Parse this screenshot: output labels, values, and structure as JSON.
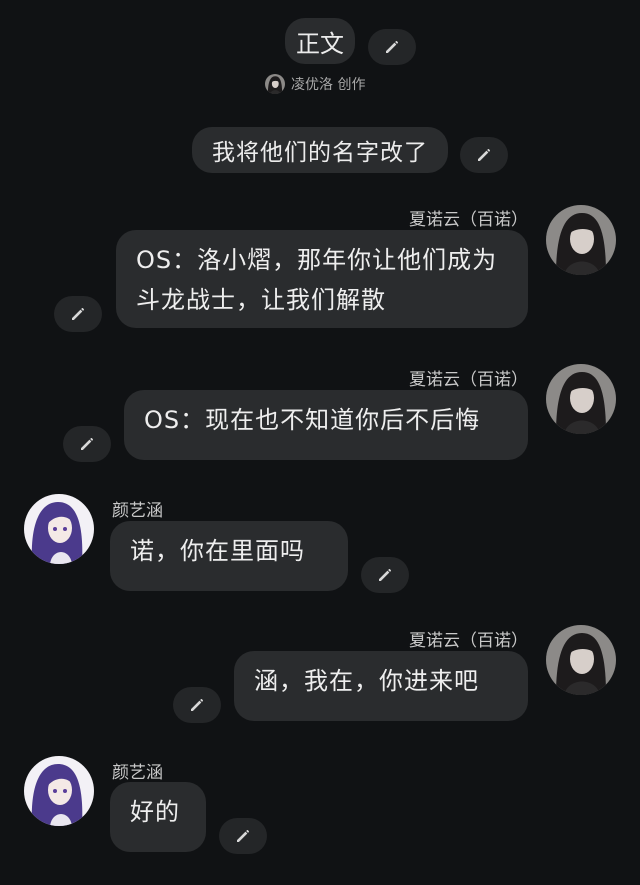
{
  "header": {
    "section_title": "正文",
    "author_credit": "凌优洛 创作"
  },
  "notice": "我将他们的名字改了",
  "messages": [
    {
      "side": "right",
      "sender": "夏诺云（百诺）",
      "text": "OS：洛小熠，那年你让他们成为斗龙战士，让我们解散"
    },
    {
      "side": "right",
      "sender": "夏诺云（百诺）",
      "text": "OS：现在也不知道你后不后悔"
    },
    {
      "side": "left",
      "sender": "颜艺涵",
      "text": "诺，你在里面吗"
    },
    {
      "side": "right",
      "sender": "夏诺云（百诺）",
      "text": "涵，我在，你进来吧"
    },
    {
      "side": "left",
      "sender": "颜艺涵",
      "text": "好的"
    }
  ],
  "icons": {
    "edit": "pencil-icon",
    "avatar_right": "dark-hair-girl-avatar",
    "avatar_left": "purple-hair-girl-avatar"
  },
  "colors": {
    "background": "#101214",
    "bubble": "#2a2c2e",
    "text": "#eeeeee"
  }
}
